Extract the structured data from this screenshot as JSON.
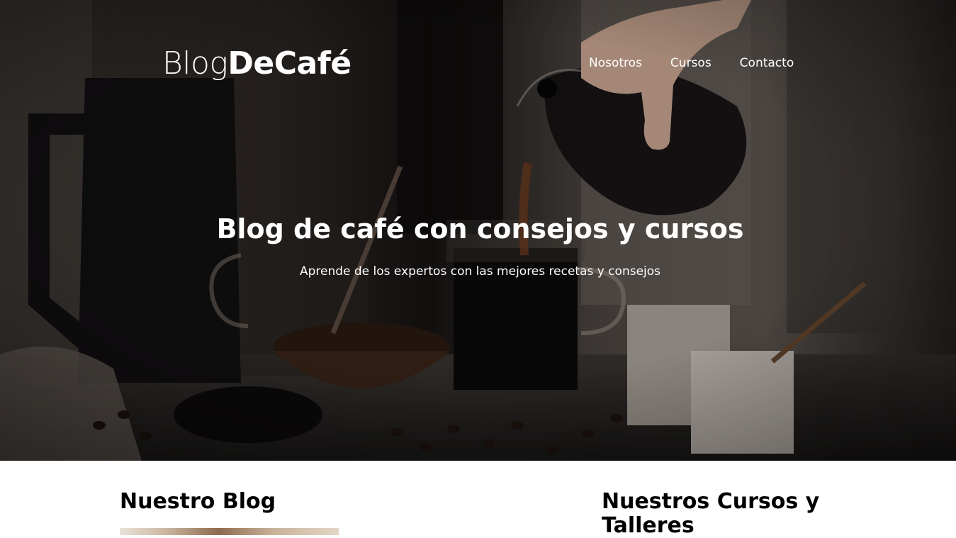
{
  "header": {
    "logo_light": "Blog",
    "logo_bold": "DeCafé",
    "nav": [
      {
        "label": "Nosotros"
      },
      {
        "label": "Cursos"
      },
      {
        "label": "Contacto"
      }
    ]
  },
  "hero": {
    "title": "Blog de café con consejos y cursos",
    "subtitle": "Aprende de los expertos con las mejores recetas y consejos"
  },
  "main": {
    "blog_heading": "Nuestro Blog",
    "courses_heading": "Nuestros Cursos y Talleres"
  },
  "colors": {
    "text_light": "#ffffff",
    "text_dark": "#000000",
    "hero_dark": "#1a1614"
  }
}
